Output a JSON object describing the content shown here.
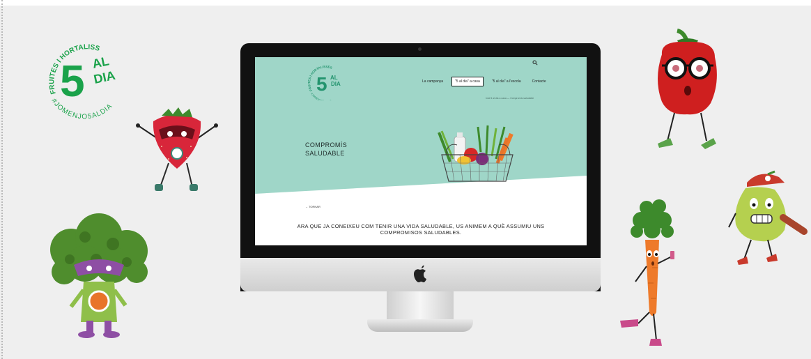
{
  "campaign_logo": {
    "arc_text": "FRUITES I HORTALISSES",
    "big_number": "5",
    "al": "AL",
    "dia": "DIA",
    "hashtag": "#JOMENJO5ALDIA"
  },
  "website": {
    "logo": {
      "number": "5",
      "al": "AL",
      "dia": "DIA",
      "arc_text": "FRUITES I HORTALISSES",
      "hashtag": "#JOMENJO5ALDIA"
    },
    "nav": [
      {
        "label": "La campanya",
        "active": false
      },
      {
        "label": "\"5 al dia\" a casa",
        "active": true
      },
      {
        "label": "\"5 al dia\" a l'escola",
        "active": false
      },
      {
        "label": "Contacte",
        "active": false
      }
    ],
    "breadcrumb": "Inici  5 al dia a casa  —  Compromís saludable",
    "hero_title_line1": "COMPROMÍS",
    "hero_title_line2": "SALUDABLE",
    "back_link": "← TORNAR",
    "intro_text": "ARA QUE JA CONEIXEU COM TENIR UNA VIDA SALUDABLE, US ANIMEM A QUÈ ASSUMIU UNS COMPROMISOS SALUDABLES."
  },
  "colors": {
    "background": "#efefef",
    "brand_green": "#1aa24a",
    "hero_mint": "#9fd6c8",
    "site_green": "#23946e",
    "strawberry": "#d8263a",
    "broccoli": "#4f8d2d",
    "pepper": "#cf1f1f",
    "pear": "#b5d04f",
    "carrot": "#ee7a2a"
  },
  "icons": [
    "search-icon",
    "apple-logo-icon"
  ]
}
